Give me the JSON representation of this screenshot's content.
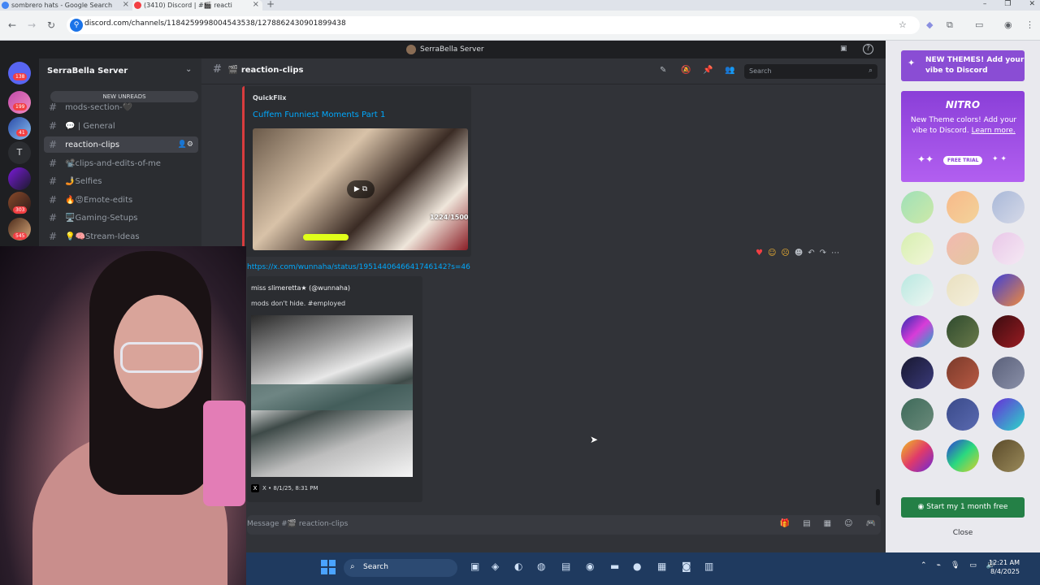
{
  "browser": {
    "tabs": [
      {
        "title": "sombrero hats - Google Search"
      },
      {
        "title": "(3410) Discord | #🎬 reacti"
      }
    ],
    "url": "discord.com/channels/1184259998004543538/1278862430901899438",
    "new_tab": "+",
    "close": "×"
  },
  "discord": {
    "window_title": "SerraBella Server",
    "server_rail": {
      "badges": [
        "138",
        "199",
        "41",
        "303",
        "545"
      ],
      "letter_server": "T"
    },
    "sidebar": {
      "server_name": "SerraBella Server",
      "new_unreads": "NEW UNREADS",
      "channels": [
        {
          "label": "mods-section-🖤"
        },
        {
          "label": "💬 | General"
        },
        {
          "label": "reaction-clips"
        },
        {
          "label": "📽️clips-and-edits-of-me"
        },
        {
          "label": "🤳Selfies"
        },
        {
          "label": "🔥😡Emote-edits"
        },
        {
          "label": "🖥️Gaming-Setups"
        },
        {
          "label": "💡🧠Stream-Ideas"
        }
      ]
    },
    "header": {
      "channel": "🎬 reaction-clips",
      "search_placeholder": "Search"
    },
    "messages": {
      "embed1": {
        "provider": "QuickFlix",
        "title": "Cuffem Funniest Moments Part 1",
        "counter": "1224/1500"
      },
      "link": "https://x.com/wunnaha/status/1951440646641746142?s=46",
      "embed2": {
        "author": "miss slimeretta★ (@wunnaha)",
        "text": "mods don't hide. #employed",
        "footer": "X • 8/1/25, 8:31 PM",
        "x_logo": "X"
      }
    },
    "composer": {
      "placeholder": "Message #🎬 reaction-clips"
    },
    "promo": {
      "new_themes": "NEW THEMES! Add your vibe to Discord",
      "nitro_logo": "NITRO",
      "nitro_text": "New Theme colors! Add your vibe to Discord.",
      "learn_more": "Learn more.",
      "free_trial": "FREE TRIAL",
      "start_button": "Start my 1 month free",
      "close_button": "Close"
    }
  },
  "taskbar": {
    "search": "Search",
    "time": "12:21 AM",
    "date": "8/4/2025"
  },
  "theme_swatches": [
    "linear-gradient(135deg,#9fe0b8,#cde9a8)",
    "linear-gradient(135deg,#f7b98a,#f3d39a)",
    "linear-gradient(135deg,#a9b8d8,#d5d9e8)",
    "linear-gradient(135deg,#d6efb0,#f2f6d8)",
    "linear-gradient(135deg,#f2b9b0,#e4c8a0)",
    "linear-gradient(135deg,#e9c7e8,#f5e9f4)",
    "linear-gradient(135deg,#b8e8e0,#eef6f2)",
    "linear-gradient(135deg,#e9e0c0,#f4efdc)",
    "linear-gradient(135deg,#3b3fd9,#f08a3c)",
    "linear-gradient(135deg,#2a2cb0,#d83cd8,#18b0c8)",
    "linear-gradient(135deg,#2e4a2e,#6a7a4a)",
    "linear-gradient(135deg,#3a0c10,#9a1c22)",
    "linear-gradient(135deg,#181830,#3a3a7a)",
    "linear-gradient(135deg,#7a3a2a,#b85a44)",
    "linear-gradient(135deg,#5a607a,#8a90a8)",
    "linear-gradient(135deg,#3e6a5a,#6a8a7a)",
    "linear-gradient(135deg,#3a4a8a,#5a6ab0)",
    "linear-gradient(135deg,#6a2ad8,#2ad8c8)",
    "linear-gradient(135deg,#f0c020,#e03a6a,#6a2ad8)",
    "linear-gradient(135deg,#2a3ad8,#2ad880,#d8d02a)",
    "linear-gradient(135deg,#5a4a2a,#9a8a5a)"
  ]
}
